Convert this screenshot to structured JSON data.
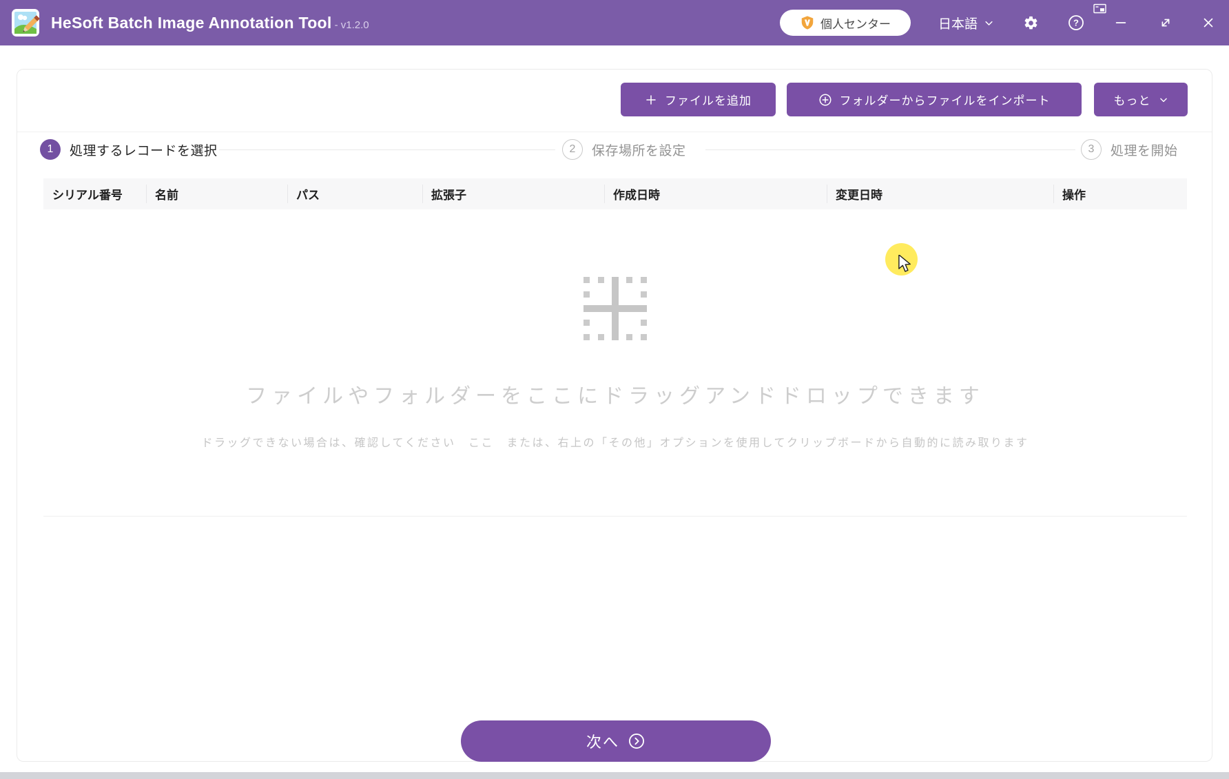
{
  "titlebar": {
    "app_title": "HeSoft Batch Image Annotation Tool",
    "version": "- v1.2.0",
    "user_center_label": "個人センター",
    "language_label": "日本語"
  },
  "toolbar": {
    "add_files_label": "ファイルを追加",
    "import_folder_label": "フォルダーからファイルをインポート",
    "more_label": "もっと"
  },
  "steps": [
    {
      "number": "1",
      "label": "処理するレコードを選択",
      "state": "active"
    },
    {
      "number": "2",
      "label": "保存場所を設定",
      "state": "inactive"
    },
    {
      "number": "3",
      "label": "処理を開始",
      "state": "inactive"
    }
  ],
  "table": {
    "columns": [
      "シリアル番号",
      "名前",
      "パス",
      "拡張子",
      "作成日時",
      "変更日時",
      "操作"
    ]
  },
  "empty_state": {
    "main_text": "ファイルやフォルダーをここにドラッグアンドドロップできます",
    "hint_text": "ドラッグできない場合は、確認してください　ここ　または、右上の「その他」オプションを使用してクリップボードから自動的に読み取ります"
  },
  "footer": {
    "next_label": "次へ"
  },
  "icons": {
    "app_logo": "picture-with-pencil",
    "vip_badge": "orange-shield-V",
    "chevron_down": "v",
    "gear": "settings-cog",
    "help": "question-circle",
    "pip": "small-window",
    "minimize": "—",
    "resize": "diagonal-double-arrow",
    "close": "×",
    "plus": "+",
    "circled_plus": "⊕",
    "drop_target": "dotted-square-plus",
    "next_arrow": "chevron-right-circle"
  },
  "colors": {
    "titlebar": "#7b5ca8",
    "accent_button": "#7a50a6",
    "step_active": "#7350a2",
    "vip_badge": "#f2a53c",
    "highlight": "#ffe94d",
    "header_bg": "#f7f7f8"
  }
}
